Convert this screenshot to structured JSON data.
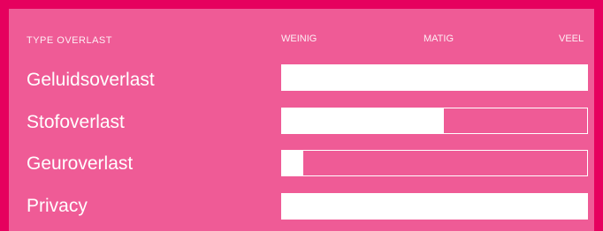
{
  "header": {
    "type_label": "TYPE OVERLAST",
    "scale": {
      "low": "WEINIG",
      "mid": "MATIG",
      "high": "VEEL"
    }
  },
  "rows": [
    {
      "label": "Geluidsoverlast",
      "level": 1.0
    },
    {
      "label": "Stofoverlast",
      "level": 0.53
    },
    {
      "label": "Geuroverlast",
      "level": 0.07
    },
    {
      "label": "Privacy",
      "level": 1.0
    }
  ],
  "colors": {
    "page_background": "#e6005e",
    "panel_background": "#ef5b96",
    "bar_fill": "#ffffff",
    "text": "#ffffff"
  }
}
